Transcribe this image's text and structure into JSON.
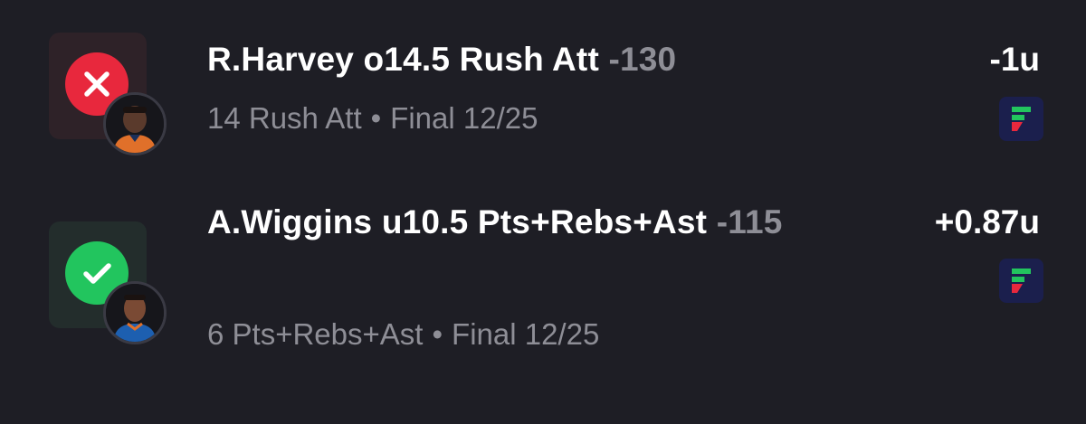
{
  "bets": [
    {
      "status": "lost",
      "status_icon": "x-icon",
      "status_color": "#e8283d",
      "tile_color": "#2e2228",
      "player_avatar": "player-avatar",
      "title": "R.Harvey o14.5 Rush Att",
      "odds": "-130",
      "result_stat": "14 Rush Att",
      "separator": "•",
      "game_status": "Final 12/25",
      "units": "-1u",
      "book_icon": "sportsbook-logo-icon"
    },
    {
      "status": "won",
      "status_icon": "checkmark-icon",
      "status_color": "#22c55e",
      "tile_color": "#232d2c",
      "player_avatar": "player-avatar",
      "title": "A.Wiggins u10.5 Pts+Rebs+Ast",
      "odds": "-115",
      "result_stat": "6 Pts+Rebs+Ast",
      "separator": "•",
      "game_status": "Final 12/25",
      "units": "+0.87u",
      "book_icon": "sportsbook-logo-icon"
    }
  ],
  "colors": {
    "background": "#1e1e25",
    "text_primary": "#ffffff",
    "text_secondary": "#8e8e96",
    "book_logo_bg": "#1b1f4d",
    "book_logo_green": "#22c55e",
    "book_logo_red": "#e8283d"
  }
}
